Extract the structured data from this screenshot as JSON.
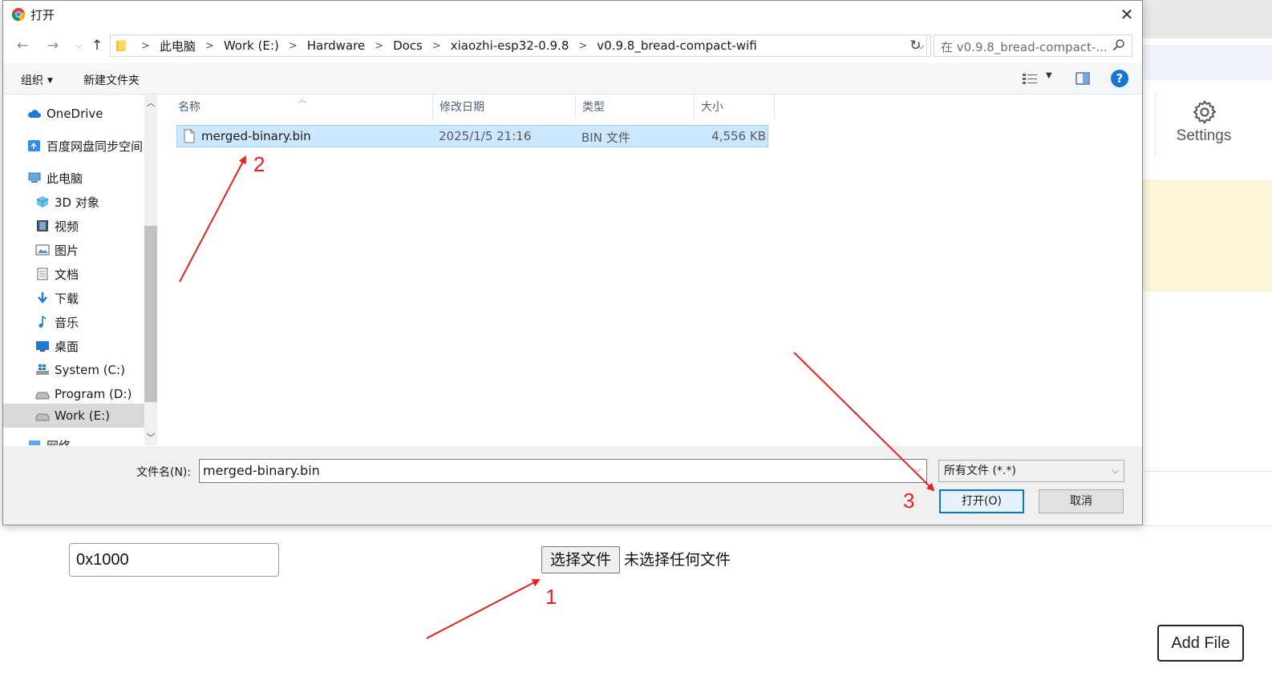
{
  "background_page": {
    "settings_label": "Settings",
    "address_value": "0x1000",
    "choose_file_label": "选择文件",
    "no_file_text": "未选择任何文件",
    "add_file_label": "Add File"
  },
  "dialog": {
    "title": "打开",
    "breadcrumbs": [
      "此电脑",
      "Work (E:)",
      "Hardware",
      "Docs",
      "xiaozhi-esp32-0.9.8",
      "v0.9.8_bread-compact-wifi"
    ],
    "search_placeholder": "在 v0.9.8_bread-compact-...",
    "toolbar": {
      "organize_label": "组织",
      "new_folder_label": "新建文件夹"
    },
    "nav_items": [
      {
        "label": "OneDrive",
        "icon": "cloud-icon"
      },
      {
        "label": "百度网盘同步空间",
        "icon": "baidu-sync-icon"
      },
      {
        "label": "此电脑",
        "icon": "computer-icon"
      },
      {
        "label": "3D 对象",
        "icon": "cube-icon"
      },
      {
        "label": "视频",
        "icon": "video-icon"
      },
      {
        "label": "图片",
        "icon": "picture-icon"
      },
      {
        "label": "文档",
        "icon": "document-icon"
      },
      {
        "label": "下载",
        "icon": "download-icon"
      },
      {
        "label": "音乐",
        "icon": "music-icon"
      },
      {
        "label": "桌面",
        "icon": "desktop-icon"
      },
      {
        "label": "System (C:)",
        "icon": "drive-windows-icon"
      },
      {
        "label": "Program (D:)",
        "icon": "drive-icon"
      },
      {
        "label": "Work (E:)",
        "icon": "drive-icon"
      },
      {
        "label": "网络",
        "icon": "network-icon"
      }
    ],
    "columns": {
      "name": "名称",
      "date": "修改日期",
      "type": "类型",
      "size": "大小"
    },
    "files": [
      {
        "name": "merged-binary.bin",
        "date": "2025/1/5 21:16",
        "type": "BIN 文件",
        "size": "4,556 KB"
      }
    ],
    "filename_label": "文件名(N):",
    "filename_value": "merged-binary.bin",
    "filetype_value": "所有文件 (*.*)",
    "open_label": "打开(O)",
    "cancel_label": "取消"
  },
  "annotations": {
    "step1": "1",
    "step2": "2",
    "step3": "3",
    "color": "#e8211d"
  }
}
